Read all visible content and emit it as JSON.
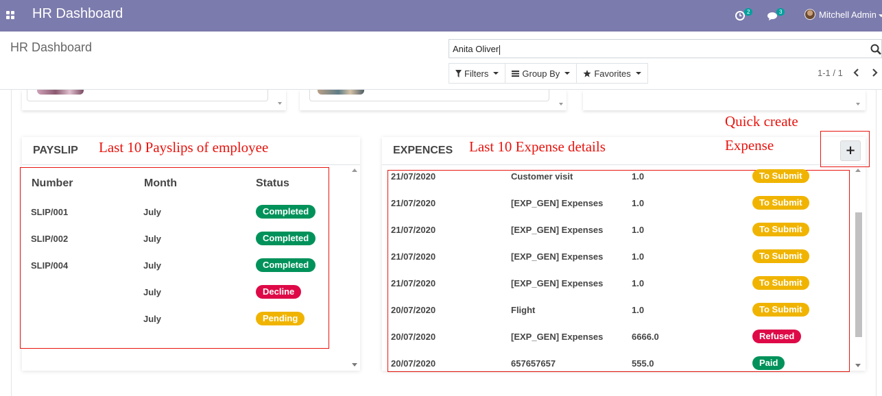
{
  "navbar": {
    "apps_icon": "apps-grid-icon",
    "title": "HR Dashboard",
    "activity_icon": "clock-icon",
    "activity_count": "2",
    "messages_icon": "chat-icon",
    "messages_count": "3",
    "user_name": "Mitchell Admin"
  },
  "control_panel": {
    "breadcrumb": "HR Dashboard",
    "search_value": "Anita Oliver",
    "filters_label": "Filters",
    "group_by_label": "Group By",
    "favorites_label": "Favorites",
    "pager": "1-1 / 1"
  },
  "payslip": {
    "title": "PAYSLIP",
    "annotation": "Last 10 Payslips of employee",
    "headers": {
      "number": "Number",
      "month": "Month",
      "status": "Status"
    },
    "rows": [
      {
        "number": "SLIP/001",
        "month": "July",
        "status": "Completed"
      },
      {
        "number": "SLIP/002",
        "month": "July",
        "status": "Completed"
      },
      {
        "number": "SLIP/004",
        "month": "July",
        "status": "Completed"
      },
      {
        "number": "",
        "month": "July",
        "status": "Decline"
      },
      {
        "number": "",
        "month": "July",
        "status": "Pending"
      }
    ]
  },
  "expenses": {
    "title": "EXPENCES",
    "annotation": "Last 10 Expense details",
    "quick_create_annotation_line1": "Quick create",
    "quick_create_annotation_line2": "Expense",
    "add_button": "+",
    "rows": [
      {
        "date": "21/07/2020",
        "description": "Customer visit",
        "amount": "1.0",
        "status": "To Submit"
      },
      {
        "date": "21/07/2020",
        "description": "[EXP_GEN] Expenses",
        "amount": "1.0",
        "status": "To Submit"
      },
      {
        "date": "21/07/2020",
        "description": "[EXP_GEN] Expenses",
        "amount": "1.0",
        "status": "To Submit"
      },
      {
        "date": "21/07/2020",
        "description": "[EXP_GEN] Expenses",
        "amount": "1.0",
        "status": "To Submit"
      },
      {
        "date": "21/07/2020",
        "description": "[EXP_GEN] Expenses",
        "amount": "1.0",
        "status": "To Submit"
      },
      {
        "date": "20/07/2020",
        "description": "Flight",
        "amount": "1.0",
        "status": "To Submit"
      },
      {
        "date": "20/07/2020",
        "description": "[EXP_GEN] Expenses",
        "amount": "6666.0",
        "status": "Refused"
      },
      {
        "date": "20/07/2020",
        "description": "657657657",
        "amount": "555.0",
        "status": "Paid"
      }
    ]
  },
  "colors": {
    "navbar": "#7c7bad",
    "completed": "#00925a",
    "decline": "#de0a47",
    "pending": "#f0b400",
    "to_submit": "#f0b400",
    "refused": "#de0a47",
    "paid": "#00925a",
    "annotation": "#e8130d"
  }
}
